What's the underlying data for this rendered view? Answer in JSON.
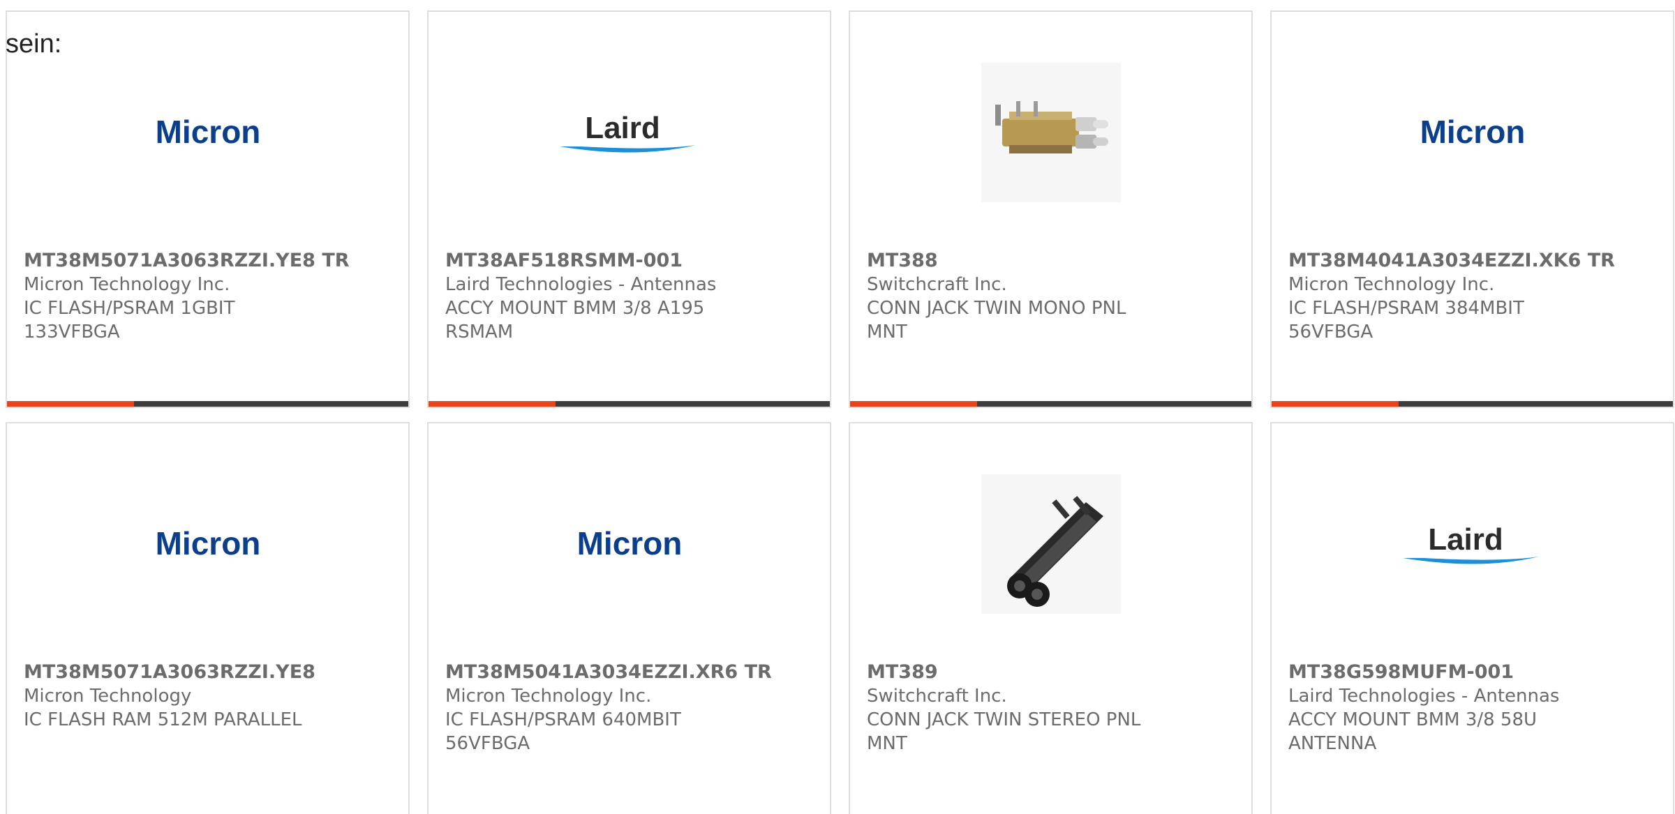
{
  "intro_text": "sein:",
  "colors": {
    "accent": "#e8431a",
    "bar_dark": "#3c3c3c",
    "text": "#6b6b6b",
    "micron_blue": "#0b3f8c",
    "laird_blue": "#1c8fd6"
  },
  "products": [
    {
      "part": "MT38M5071A3063RZZI.YE8 TR",
      "maker": "Micron Technology Inc.",
      "desc1": "IC FLASH/PSRAM 1GBIT",
      "desc2": "133VFBGA",
      "image": "micron-logo"
    },
    {
      "part": "MT38AF518RSMM-001",
      "maker": "Laird Technologies - Antennas",
      "desc1": "ACCY MOUNT BMM 3/8 A195",
      "desc2": "RSMAM",
      "image": "laird-logo"
    },
    {
      "part": "MT388",
      "maker": "Switchcraft Inc.",
      "desc1": "CONN JACK TWIN MONO PNL",
      "desc2": "MNT",
      "image": "jack-photo-mono"
    },
    {
      "part": "MT38M4041A3034EZZI.XK6 TR",
      "maker": "Micron Technology Inc.",
      "desc1": "IC FLASH/PSRAM 384MBIT",
      "desc2": "56VFBGA",
      "image": "micron-logo"
    },
    {
      "part": "MT38M5071A3063RZZI.YE8",
      "maker": "Micron Technology",
      "desc1": "IC FLASH RAM 512M PARALLEL",
      "desc2": "",
      "image": "micron-logo"
    },
    {
      "part": "MT38M5041A3034EZZI.XR6 TR",
      "maker": "Micron Technology Inc.",
      "desc1": "IC FLASH/PSRAM 640MBIT",
      "desc2": "56VFBGA",
      "image": "micron-logo"
    },
    {
      "part": "MT389",
      "maker": "Switchcraft Inc.",
      "desc1": "CONN JACK TWIN STEREO PNL",
      "desc2": "MNT",
      "image": "jack-photo-stereo"
    },
    {
      "part": "MT38G598MUFM-001",
      "maker": "Laird Technologies - Antennas",
      "desc1": "ACCY MOUNT BMM 3/8 58U",
      "desc2": "ANTENNA",
      "image": "laird-logo"
    }
  ],
  "logos": {
    "micron": "Micron",
    "laird": "Laird"
  }
}
